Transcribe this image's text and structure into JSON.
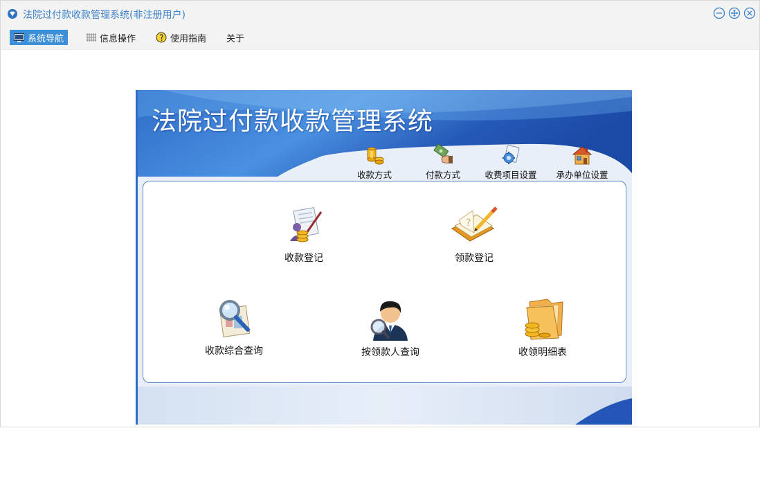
{
  "window": {
    "title": "法院过付款收款管理系统(非注册用户)"
  },
  "menu": [
    {
      "label": "系统导航",
      "icon": "monitor-icon",
      "active": true
    },
    {
      "label": "信息操作",
      "icon": "grid-icon",
      "active": false
    },
    {
      "label": "使用指南",
      "icon": "lightbulb-icon",
      "active": false
    },
    {
      "label": "关于",
      "icon": "",
      "active": false
    }
  ],
  "panel": {
    "title": "法院过付款收款管理系统",
    "toolbar": [
      {
        "label": "收款方式",
        "icon": "coins-icon"
      },
      {
        "label": "付款方式",
        "icon": "money-hand-icon"
      },
      {
        "label": "收费项目设置",
        "icon": "settings-document-icon"
      },
      {
        "label": "承办单位设置",
        "icon": "house-icon"
      }
    ],
    "actions": [
      {
        "label": "收款登记",
        "icon": "receipt-register-icon"
      },
      {
        "label": "领款登记",
        "icon": "notebook-pencil-icon"
      },
      {
        "label": "收款综合查询",
        "icon": "magnifier-document-icon"
      },
      {
        "label": "按领款人查询",
        "icon": "person-search-icon"
      },
      {
        "label": "收领明细表",
        "icon": "folder-coins-icon"
      }
    ]
  },
  "colors": {
    "accent": "#3d8fd8",
    "title_text": "#3a7fc9",
    "banner_dark": "#1e54b4",
    "banner_light": "#5aa6ec",
    "box_border": "#5a86c4"
  }
}
